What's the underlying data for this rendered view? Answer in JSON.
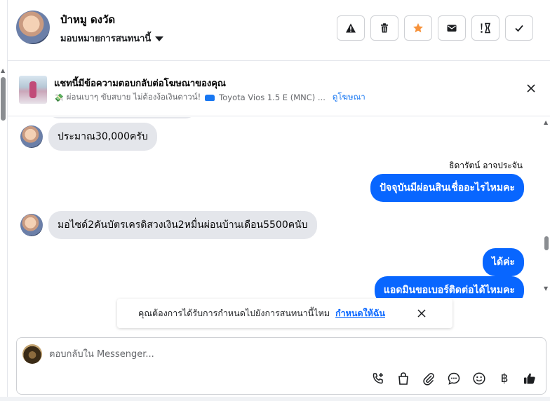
{
  "header": {
    "contact_name": "ป๋าหมู ดงวัด",
    "assign_label": "มอบหมายการสนทนานี้",
    "action_icons": [
      "warning-icon",
      "trash-icon",
      "star-icon",
      "envelope-icon",
      "priority-icon",
      "check-icon"
    ],
    "star_color": "#f7923a"
  },
  "ad_banner": {
    "title": "แชทนี้มีข้อความตอบกลับต่อโฆษณาของคุณ",
    "subtitle": "ผ่อนเบาๆ ขับสบาย ไม่ต้องง้อเงินดาวน์!",
    "vehicle": "Toyota Vios 1.5 E (MNC) ...",
    "view_link": "ดูโฆษณา"
  },
  "conversation": {
    "messages": [
      {
        "direction": "incoming",
        "text": "ประมาณ30,000ครับ"
      },
      {
        "direction": "outgoing",
        "sender": "ธิดารัตน์ อาจประจัน",
        "text": "ปัจจุบันมีผ่อนสินเชื่ออะไรไหมคะ"
      },
      {
        "direction": "incoming",
        "text": "มอไซด์2คันบัตรเครดิสวงเงิน2หมื่นผ่อนบ้านเดือน5500คนับ"
      },
      {
        "direction": "outgoing",
        "text": "ได้ค่ะ"
      },
      {
        "direction": "outgoing",
        "text": "แอดมินขอเบอร์ติดต่อได้ไหมคะ"
      }
    ],
    "outgoing_color": "#0866ff",
    "incoming_color": "#e4e6eb"
  },
  "toast": {
    "text": "คุณต้องการได้รับการกำหนดไปยังการสนทนานี้ไหม",
    "link": "กำหนดให้ฉัน"
  },
  "composer": {
    "placeholder": "ตอบกลับใน Messenger...",
    "tool_icons": [
      "phone-add-icon",
      "shopping-bag-icon",
      "paperclip-icon",
      "chat-bubble-icon",
      "emoji-icon",
      "baht-icon",
      "thumbs-up-icon"
    ],
    "baht_symbol": "฿"
  }
}
